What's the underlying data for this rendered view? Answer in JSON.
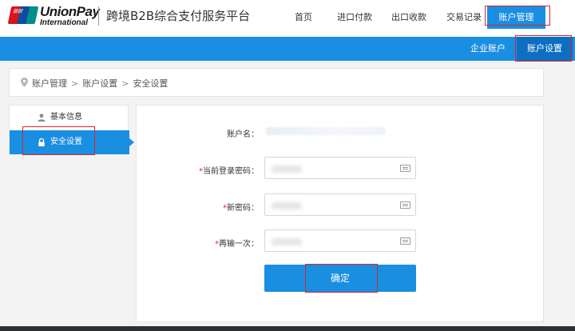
{
  "header": {
    "logo_badge": "银联",
    "brand": "UnionPay",
    "brand_sub": "International",
    "platform_title": "跨境B2B综合支付服务平台",
    "nav": [
      {
        "label": "首页"
      },
      {
        "label": "进口付款"
      },
      {
        "label": "出口收款"
      },
      {
        "label": "交易记录"
      },
      {
        "label": "账户管理",
        "active": true
      }
    ]
  },
  "subnav": [
    {
      "label": "企业账户"
    },
    {
      "label": "账户设置",
      "active": true
    }
  ],
  "breadcrumb": {
    "items": [
      "账户管理",
      "账户设置",
      "安全设置"
    ],
    "separator": ">"
  },
  "sidebar": {
    "items": [
      {
        "label": "基本信息",
        "icon": "user-icon"
      },
      {
        "label": "安全设置",
        "icon": "lock-icon",
        "active": true
      }
    ]
  },
  "form": {
    "account_label": "账户名：",
    "current_password_label": "当前登录密码：",
    "new_password_label": "新密码：",
    "repeat_password_label": "再输一次：",
    "required_mark": "*",
    "confirm_label": "确定"
  },
  "colors": {
    "primary": "#1a8ee1",
    "primary_dark": "#0e6fc2",
    "required": "#e0262a",
    "annotation": "#d9262b"
  }
}
